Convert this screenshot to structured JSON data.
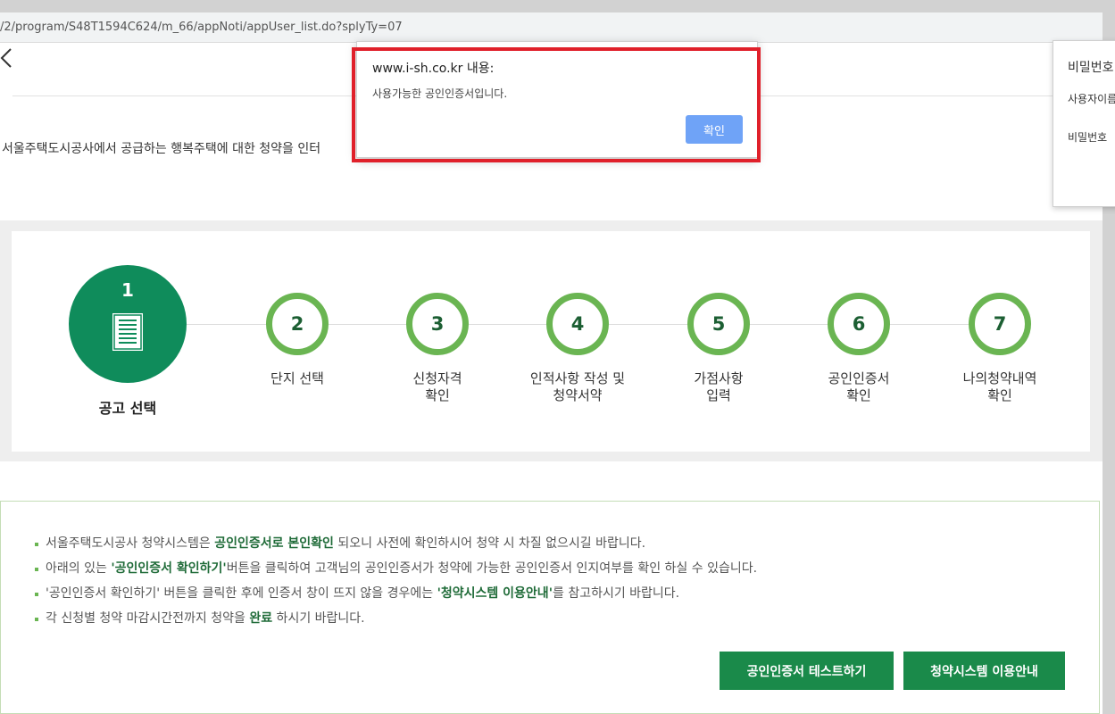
{
  "browser": {
    "url": "/2/program/S48T1594C624/m_66/appNoti/appUser_list.do?splyTy=07"
  },
  "page": {
    "intro": "서울주택도시공사에서 공급하는 행복주택에 대한 청약을 인터",
    "steps": [
      {
        "num": "1",
        "label": "공고 선택"
      },
      {
        "num": "2",
        "label": "단지 선택"
      },
      {
        "num": "3",
        "label_line1": "신청자격",
        "label_line2": "확인"
      },
      {
        "num": "4",
        "label_line1": "인적사항 작성 및",
        "label_line2": "청약서약"
      },
      {
        "num": "5",
        "label_line1": "가점사항",
        "label_line2": "입력"
      },
      {
        "num": "6",
        "label_line1": "공인인증서",
        "label_line2": "확인"
      },
      {
        "num": "7",
        "label_line1": "나의청약내역",
        "label_line2": "확인"
      }
    ],
    "notices": {
      "n1_a": "서울주택도시공사 청약시스템은 ",
      "n1_b": "공인인증서로 본인확인",
      "n1_c": " 되오니 사전에 확인하시어 청약 시 차질 없으시길 바랍니다.",
      "n2_a": "아래의 있는 ",
      "n2_b": "'공인인증서 확인하기'",
      "n2_c": "버튼을 클릭하여 고객님의 공인인증서가 청약에 가능한 공인인증서 인지여부를 확인 하실 수 있습니다.",
      "n3_a": "'공인인증서 확인하기' 버튼을 클릭한 후에 인증서 창이 뜨지 않을 경우에는 ",
      "n3_b": "'청약시스템 이용안내'",
      "n3_c": "를 참고하시기 바랍니다.",
      "n4_a": "각 신청별 청약 마감시간전까지 청약을 ",
      "n4_b": "완료",
      "n4_c": " 하시기 바랍니다."
    },
    "buttons": {
      "cert_test": "공인인증서 테스트하기",
      "guide": "청약시스템 이용안내"
    }
  },
  "side_panel": {
    "title": "비밀번호",
    "line1": "사용자이름",
    "line2": "비밀번호"
  },
  "dialog": {
    "title": "www.i-sh.co.kr 내용:",
    "message": "사용가능한 공인인증서입니다.",
    "ok_label": "확인"
  },
  "colors": {
    "primary_green": "#0f8c5b",
    "step_ring": "#6ab552",
    "button_green": "#1a8a4a",
    "dialog_ok": "#6fa3f7",
    "highlight_red": "#e0202a"
  }
}
